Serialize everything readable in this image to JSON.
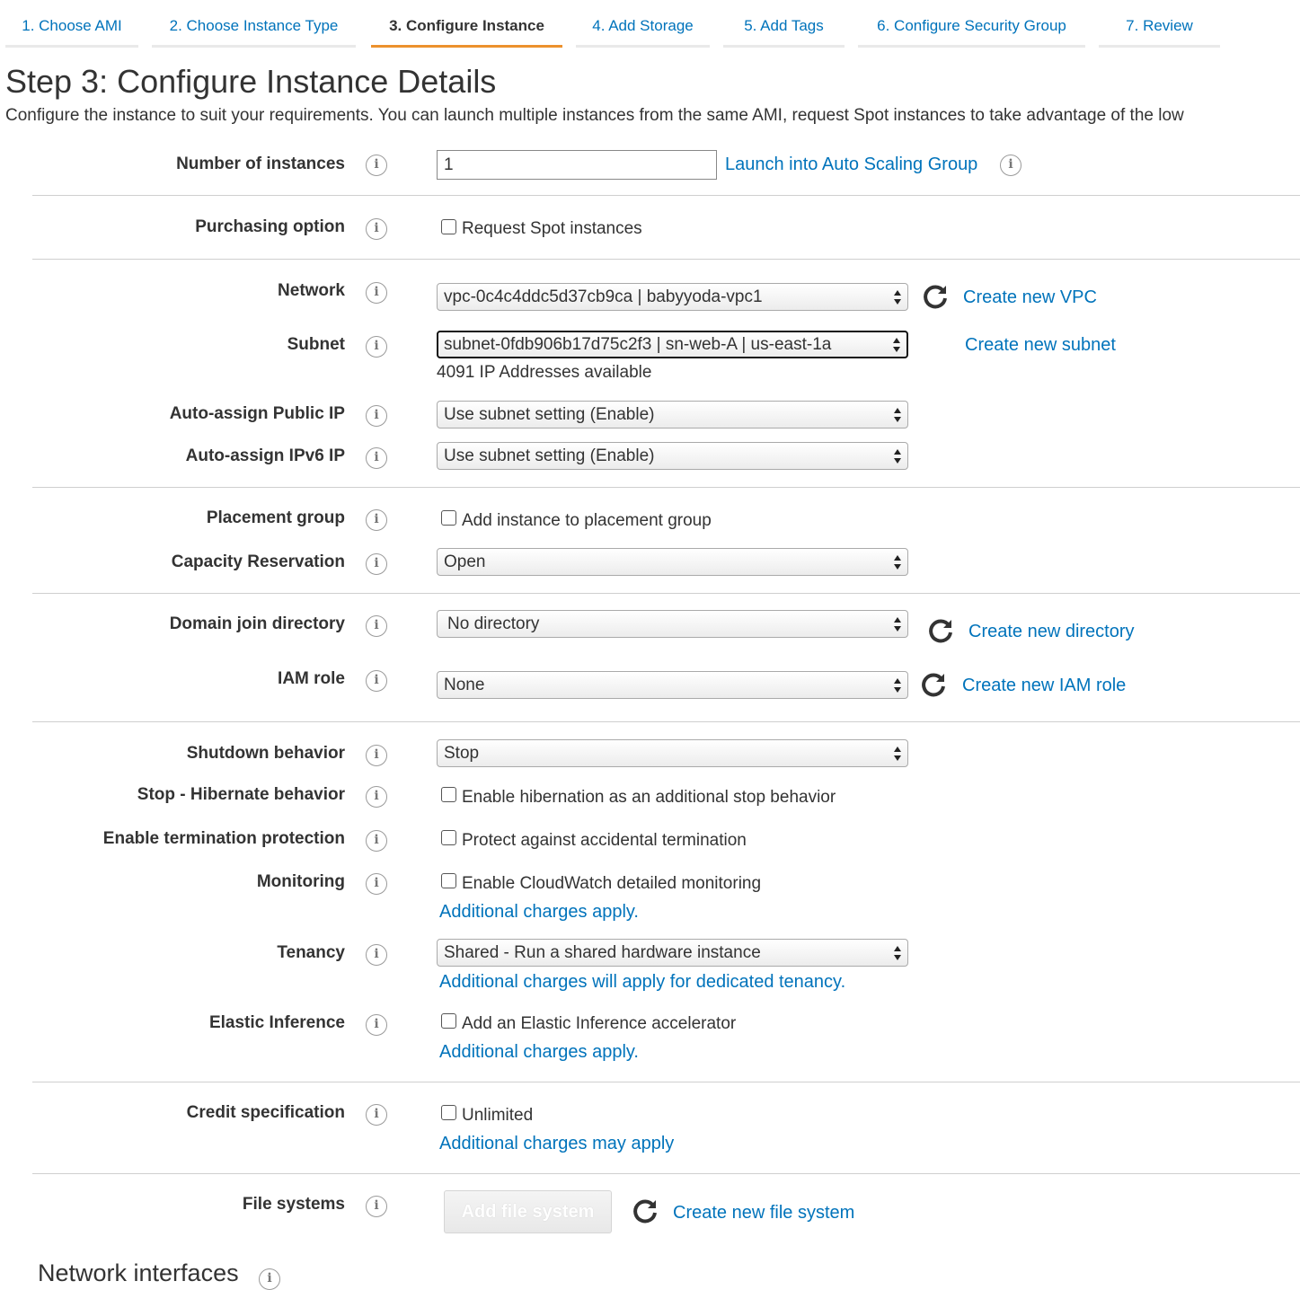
{
  "tabs": [
    {
      "label": "1. Choose AMI"
    },
    {
      "label": "2. Choose Instance Type"
    },
    {
      "label": "3. Configure Instance"
    },
    {
      "label": "4. Add Storage"
    },
    {
      "label": "5. Add Tags"
    },
    {
      "label": "6. Configure Security Group"
    },
    {
      "label": "7. Review"
    }
  ],
  "page": {
    "title": "Step 3: Configure Instance Details",
    "subtitle": "Configure the instance to suit your requirements. You can launch multiple instances from the same AMI, request Spot instances to take advantage of the low"
  },
  "form": {
    "instances": {
      "label": "Number of instances",
      "value": "1",
      "link": "Launch into Auto Scaling Group"
    },
    "purchasing": {
      "label": "Purchasing option",
      "checkbox": "Request Spot instances"
    },
    "network": {
      "label": "Network",
      "value": "vpc-0c4c4ddc5d37cb9ca | babyyoda-vpc1",
      "link": "Create new VPC"
    },
    "subnet": {
      "label": "Subnet",
      "value": "subnet-0fdb906b17d75c2f3 | sn-web-A | us-east-1a",
      "note": "4091 IP Addresses available",
      "link": "Create new subnet"
    },
    "public_ip": {
      "label": "Auto-assign Public IP",
      "value": "Use subnet setting (Enable)"
    },
    "ipv6": {
      "label": "Auto-assign IPv6 IP",
      "value": "Use subnet setting (Enable)"
    },
    "placement": {
      "label": "Placement group",
      "checkbox": "Add instance to placement group"
    },
    "capacity": {
      "label": "Capacity Reservation",
      "value": "Open"
    },
    "domain": {
      "label": "Domain join directory",
      "value": "No directory",
      "link": "Create new directory"
    },
    "iam": {
      "label": "IAM role",
      "value": "None",
      "link": "Create new IAM role"
    },
    "shutdown": {
      "label": "Shutdown behavior",
      "value": "Stop"
    },
    "hibernate": {
      "label": "Stop - Hibernate behavior",
      "checkbox": "Enable hibernation as an additional stop behavior"
    },
    "termination": {
      "label": "Enable termination protection",
      "checkbox": "Protect against accidental termination"
    },
    "monitoring": {
      "label": "Monitoring",
      "checkbox": "Enable CloudWatch detailed monitoring",
      "link": "Additional charges apply."
    },
    "tenancy": {
      "label": "Tenancy",
      "value": "Shared - Run a shared hardware instance",
      "link": "Additional charges will apply for dedicated tenancy."
    },
    "elastic": {
      "label": "Elastic Inference",
      "checkbox": "Add an Elastic Inference accelerator",
      "link": "Additional charges apply."
    },
    "credit": {
      "label": "Credit specification",
      "checkbox": "Unlimited",
      "link": "Additional charges may apply"
    },
    "filesystems": {
      "label": "File systems",
      "button": "Add file system",
      "link": "Create new file system"
    },
    "network_interfaces": {
      "label": "Network interfaces"
    }
  },
  "colors": {
    "link": "#0073bb",
    "active_tab": "#ec912d"
  },
  "icons": {
    "info": "info-circle-icon",
    "refresh": "refresh-icon",
    "select_arrows": "updown-arrows-icon"
  }
}
